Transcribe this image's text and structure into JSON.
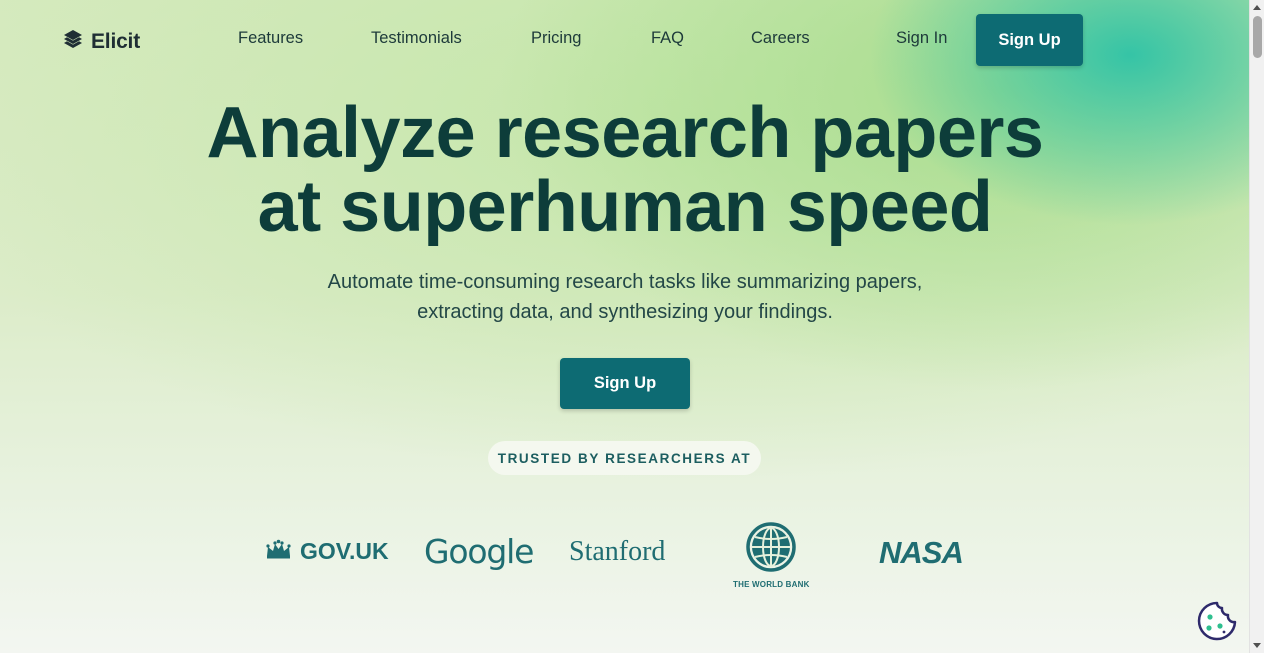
{
  "brand": {
    "name": "Elicit"
  },
  "nav": {
    "links": [
      "Features",
      "Testimonials",
      "Pricing",
      "FAQ",
      "Careers"
    ],
    "signin_label": "Sign In",
    "signup_label": "Sign Up"
  },
  "hero": {
    "title_line1": "Analyze research papers",
    "title_line2": "at superhuman speed",
    "subtitle_line1": "Automate time-consuming research tasks like summarizing papers,",
    "subtitle_line2": "extracting data, and synthesizing your findings.",
    "cta_label": "Sign Up"
  },
  "trusted": {
    "label": "TRUSTED BY RESEARCHERS AT",
    "orgs": [
      "GOV.UK",
      "Google",
      "Stanford",
      "THE WORLD BANK",
      "NASA"
    ]
  },
  "colors": {
    "primary": "#0d6b73",
    "heading": "#0d3d3a",
    "logo_teal": "#1f6d72",
    "accent_green": "#35c4a6"
  },
  "icons": [
    "elicit-logo-icon",
    "crown-icon",
    "globe-icon",
    "cookie-icon"
  ]
}
